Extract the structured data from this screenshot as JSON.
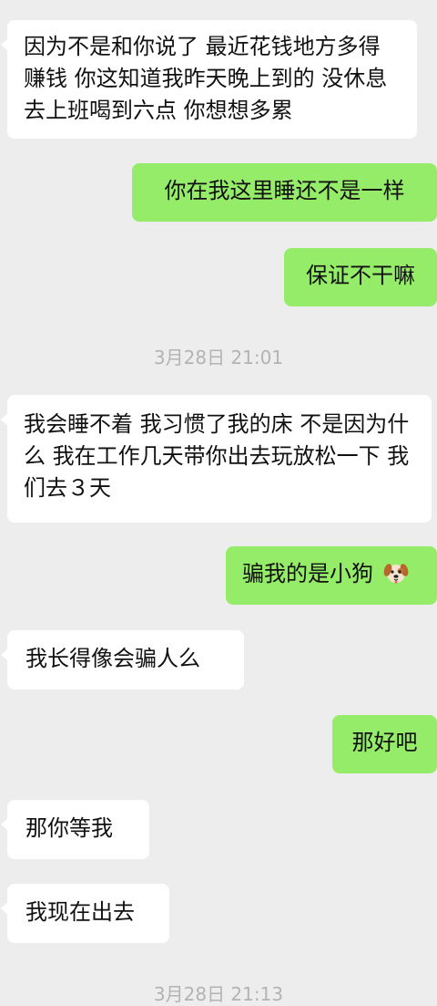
{
  "messages": [
    {
      "side": "in",
      "text": "因为不是和你说了 最近花钱地方多得赚钱 你这知道我昨天晚上到的 没休息去上班喝到六点 你想想多累"
    },
    {
      "side": "out",
      "text": "你在我这里睡还不是一样"
    },
    {
      "side": "out",
      "text": "保证不干嘛"
    },
    {
      "side": "time",
      "text": "3月28日 21:01"
    },
    {
      "side": "in",
      "text": "我会睡不着 我习惯了我的床 不是因为什么 我在工作几天带你出去玩放松一下 我们去３天"
    },
    {
      "side": "out",
      "text": "骗我的是小狗",
      "icon": "dog-face-icon"
    },
    {
      "side": "in",
      "text": "我长得像会骗人么"
    },
    {
      "side": "out",
      "text": "那好吧"
    },
    {
      "side": "in",
      "text": "那你等我"
    },
    {
      "side": "in",
      "text": "我现在出去"
    },
    {
      "side": "time",
      "text": "3月28日 21:13"
    }
  ],
  "colors": {
    "background": "#ededed",
    "incoming_bubble": "#ffffff",
    "outgoing_bubble": "#95ec69",
    "timestamp": "#b3b3b3"
  }
}
